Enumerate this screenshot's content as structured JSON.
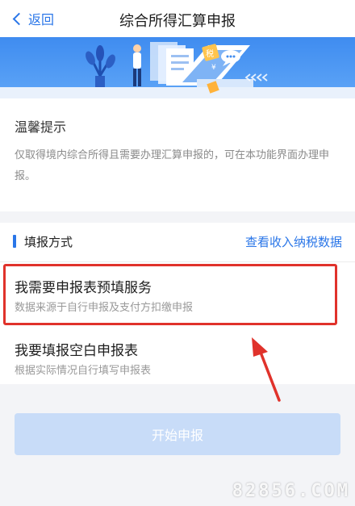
{
  "header": {
    "back_label": "返回",
    "title": "综合所得汇算申报"
  },
  "tip": {
    "title": "温馨提示",
    "text": "仅取得境内综合所得且需要办理汇算申报的，可在本功能界面办理申报。"
  },
  "method": {
    "title": "填报方式",
    "link": "查看收入纳税数据",
    "options": [
      {
        "title": "我需要申报表预填服务",
        "subtitle": "数据来源于自行申报及支付方扣缴申报",
        "highlighted": true
      },
      {
        "title": "我要填报空白申报表",
        "subtitle": "根据实际情况自行填写申报表",
        "highlighted": false
      }
    ]
  },
  "start_button": {
    "label": "开始申报"
  },
  "watermark": "82856.COM",
  "colors": {
    "accent": "#2a76e8",
    "highlight": "#e0322b",
    "button_disabled": "#c8dcf8"
  }
}
